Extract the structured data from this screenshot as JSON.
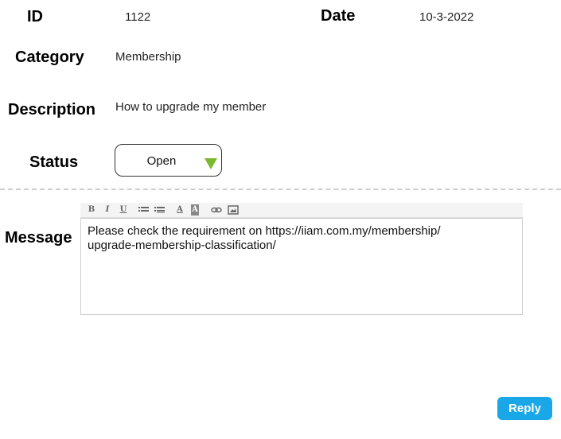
{
  "form": {
    "id_label": "ID",
    "id_value": "1122",
    "date_label": "Date",
    "date_value": "10-3-2022",
    "category_label": "Category",
    "category_value": "Membership",
    "description_label": "Description",
    "description_value": "How to upgrade my member",
    "status_label": "Status",
    "status_value": "Open",
    "message_label": "Message"
  },
  "editor": {
    "toolbar": {
      "bold": "B",
      "italic": "I",
      "underline": "U",
      "font_color": "A",
      "highlight": "A"
    },
    "content_line1": "Please check the requirement on https://iiam.com.my/membership/",
    "content_line2": "upgrade-membership-classification/"
  },
  "actions": {
    "reply_label": "Reply"
  },
  "colors": {
    "accent": "#1aa7e8",
    "status_arrow": "#7cb82f"
  }
}
